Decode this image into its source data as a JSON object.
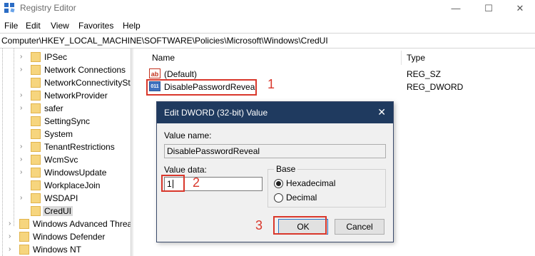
{
  "window": {
    "title": "Registry Editor",
    "controls": {
      "minimize": "—",
      "maximize": "☐",
      "close": "✕"
    }
  },
  "menu": [
    "File",
    "Edit",
    "View",
    "Favorites",
    "Help"
  ],
  "address": "Computer\\HKEY_LOCAL_MACHINE\\SOFTWARE\\Policies\\Microsoft\\Windows\\CredUI",
  "tree": {
    "items": [
      {
        "label": "IPSec",
        "expander": "›"
      },
      {
        "label": "Network Connections",
        "expander": "›"
      },
      {
        "label": "NetworkConnectivityStatusIndicator",
        "expander": ""
      },
      {
        "label": "NetworkProvider",
        "expander": "›"
      },
      {
        "label": "safer",
        "expander": "›"
      },
      {
        "label": "SettingSync",
        "expander": ""
      },
      {
        "label": "System",
        "expander": ""
      },
      {
        "label": "TenantRestrictions",
        "expander": "›"
      },
      {
        "label": "WcmSvc",
        "expander": "›"
      },
      {
        "label": "WindowsUpdate",
        "expander": "›"
      },
      {
        "label": "WorkplaceJoin",
        "expander": ""
      },
      {
        "label": "WSDAPI",
        "expander": "›"
      },
      {
        "label": "CredUI",
        "expander": ""
      },
      {
        "label": "Windows Advanced Threat Protection",
        "expander": "›"
      },
      {
        "label": "Windows Defender",
        "expander": "›"
      },
      {
        "label": "Windows NT",
        "expander": "›"
      }
    ]
  },
  "list": {
    "headers": {
      "name": "Name",
      "type": "Type"
    },
    "rows": [
      {
        "icon": "ab",
        "name": "(Default)",
        "type": "REG_SZ"
      },
      {
        "icon": "011",
        "name": "DisablePasswordReveal",
        "type": "REG_DWORD"
      }
    ]
  },
  "dialog": {
    "title": "Edit DWORD (32-bit) Value",
    "close": "✕",
    "value_name_label": "Value name:",
    "value_name": "DisablePasswordReveal",
    "value_data_label": "Value data:",
    "value_data": "1",
    "base_label": "Base",
    "base_options": [
      "Hexadecimal",
      "Decimal"
    ],
    "base_selected": "Hexadecimal",
    "ok_label": "OK",
    "cancel_label": "Cancel"
  },
  "annotations": {
    "step1": "1",
    "step2": "2",
    "step3": "3",
    "color": "#d9372b"
  }
}
